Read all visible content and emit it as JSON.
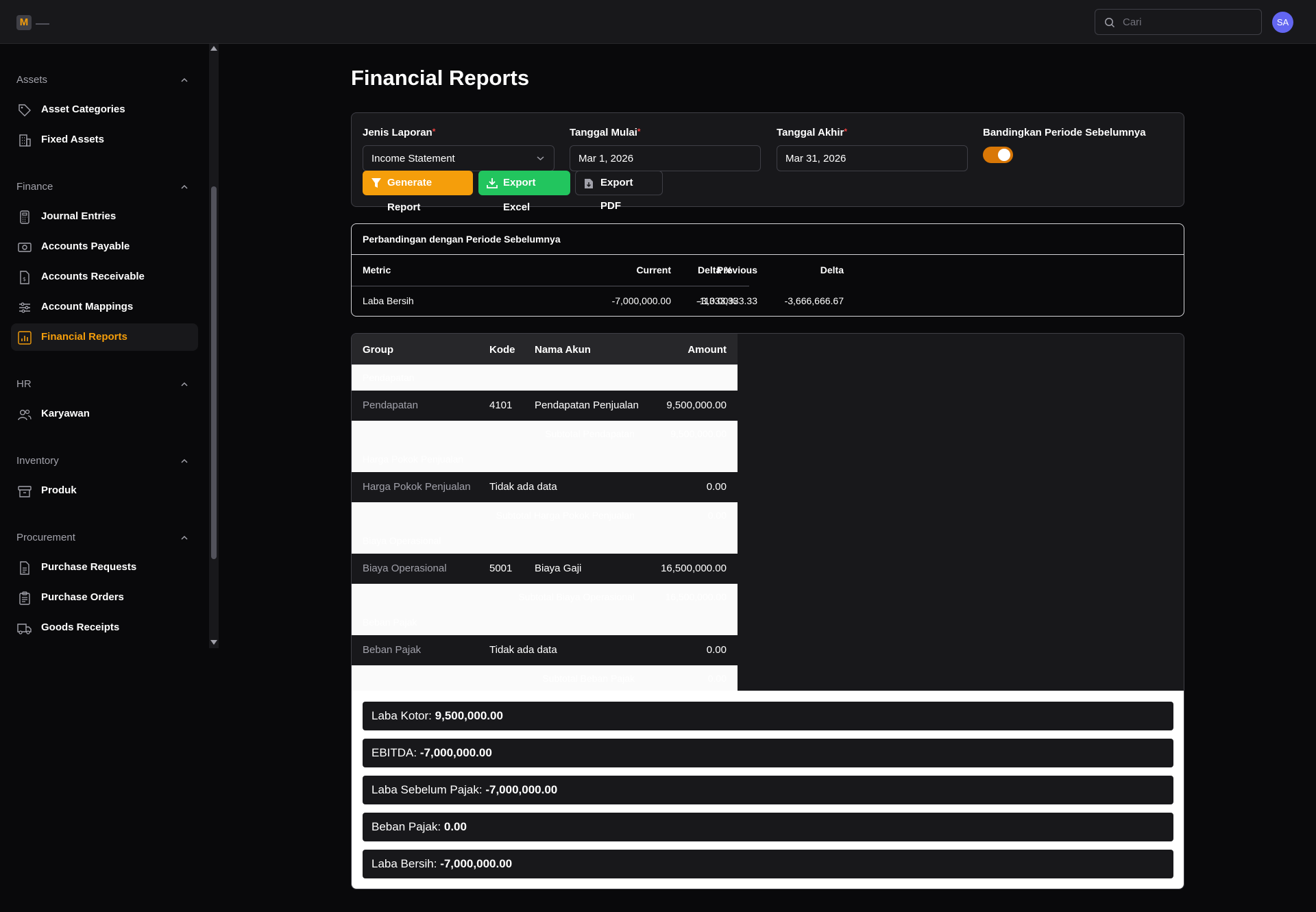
{
  "header": {
    "logo_letter": "M",
    "search_placeholder": "Cari",
    "avatar_initials": "SA"
  },
  "sidebar": {
    "groups": [
      {
        "title": "Assets",
        "items": [
          {
            "label": "Asset Categories",
            "icon": "tag-icon"
          },
          {
            "label": "Fixed Assets",
            "icon": "building-icon"
          }
        ]
      },
      {
        "title": "Finance",
        "items": [
          {
            "label": "Journal Entries",
            "icon": "calculator-icon"
          },
          {
            "label": "Accounts Payable",
            "icon": "banknotes-icon"
          },
          {
            "label": "Accounts Receivable",
            "icon": "document-dollar-icon"
          },
          {
            "label": "Account Mappings",
            "icon": "sliders-icon"
          },
          {
            "label": "Financial Reports",
            "icon": "chart-bar-icon",
            "active": true
          }
        ]
      },
      {
        "title": "HR",
        "items": [
          {
            "label": "Karyawan",
            "icon": "users-icon"
          }
        ]
      },
      {
        "title": "Inventory",
        "items": [
          {
            "label": "Produk",
            "icon": "archive-box-icon"
          }
        ]
      },
      {
        "title": "Procurement",
        "items": [
          {
            "label": "Purchase Requests",
            "icon": "document-icon"
          },
          {
            "label": "Purchase Orders",
            "icon": "clipboard-icon"
          },
          {
            "label": "Goods Receipts",
            "icon": "truck-icon"
          }
        ]
      }
    ]
  },
  "page": {
    "title": "Financial Reports"
  },
  "filters": {
    "report_type_label": "Jenis Laporan",
    "report_type_value": "Income Statement",
    "start_label": "Tanggal Mulai",
    "start_value": "Mar 1, 2026",
    "end_label": "Tanggal Akhir",
    "end_value": "Mar 31, 2026",
    "compare_label": "Bandingkan Periode Sebelumnya",
    "compare_on": true,
    "required_mark": "*",
    "generate_label": "Generate Report",
    "export_excel_label": "Export Excel",
    "export_pdf_label": "Export PDF"
  },
  "comparison": {
    "title": "Perbandingan dengan Periode Sebelumnya",
    "headers": [
      "Metric",
      "Current",
      "Previous",
      "Delta",
      "Delta %"
    ],
    "rows": [
      [
        "Laba Bersih",
        "-7,000,000.00",
        "-3,333,333.33",
        "-3,666,666.67",
        "-110.00%"
      ]
    ]
  },
  "report": {
    "headers": [
      "Group",
      "Kode",
      "Nama Akun",
      "Amount"
    ],
    "sections": [
      {
        "group": "Pendapatan",
        "row": {
          "group": "Pendapatan",
          "kode": "4101",
          "nama": "Pendapatan Penjualan",
          "amount": "9,500,000.00"
        },
        "subtotal_label": "Subtotal Pendapatan",
        "subtotal": "9,500,000.00"
      },
      {
        "group": "Harga Pokok Penjualan",
        "row": {
          "group": "Harga Pokok Penjualan",
          "kode": "Tidak ada data",
          "nama": "",
          "amount": "0.00"
        },
        "subtotal_label": "Subtotal Harga Pokok Penjualan",
        "subtotal": "0.00"
      },
      {
        "group": "Biaya Operasional",
        "row": {
          "group": "Biaya Operasional",
          "kode": "5001",
          "nama": "Biaya Gaji",
          "amount": "16,500,000.00"
        },
        "subtotal_label": "Subtotal Biaya Operasional",
        "subtotal": "16,500,000.00"
      },
      {
        "group": "Beban Pajak",
        "row": {
          "group": "Beban Pajak",
          "kode": "Tidak ada data",
          "nama": "",
          "amount": "0.00"
        },
        "subtotal_label": "Subtotal Beban Pajak",
        "subtotal": "0.00"
      }
    ],
    "totals": [
      {
        "label": "Laba Kotor:",
        "value": "9,500,000.00"
      },
      {
        "label": "EBITDA:",
        "value": "-7,000,000.00"
      },
      {
        "label": "Laba Sebelum Pajak:",
        "value": "-7,000,000.00"
      },
      {
        "label": "Beban Pajak:",
        "value": "0.00"
      },
      {
        "label": "Laba Bersih:",
        "value": "-7,000,000.00"
      }
    ]
  },
  "colors": {
    "accent": "#f59e0b",
    "success": "#22c55e",
    "background": "#09090b",
    "surface": "#18181b"
  }
}
